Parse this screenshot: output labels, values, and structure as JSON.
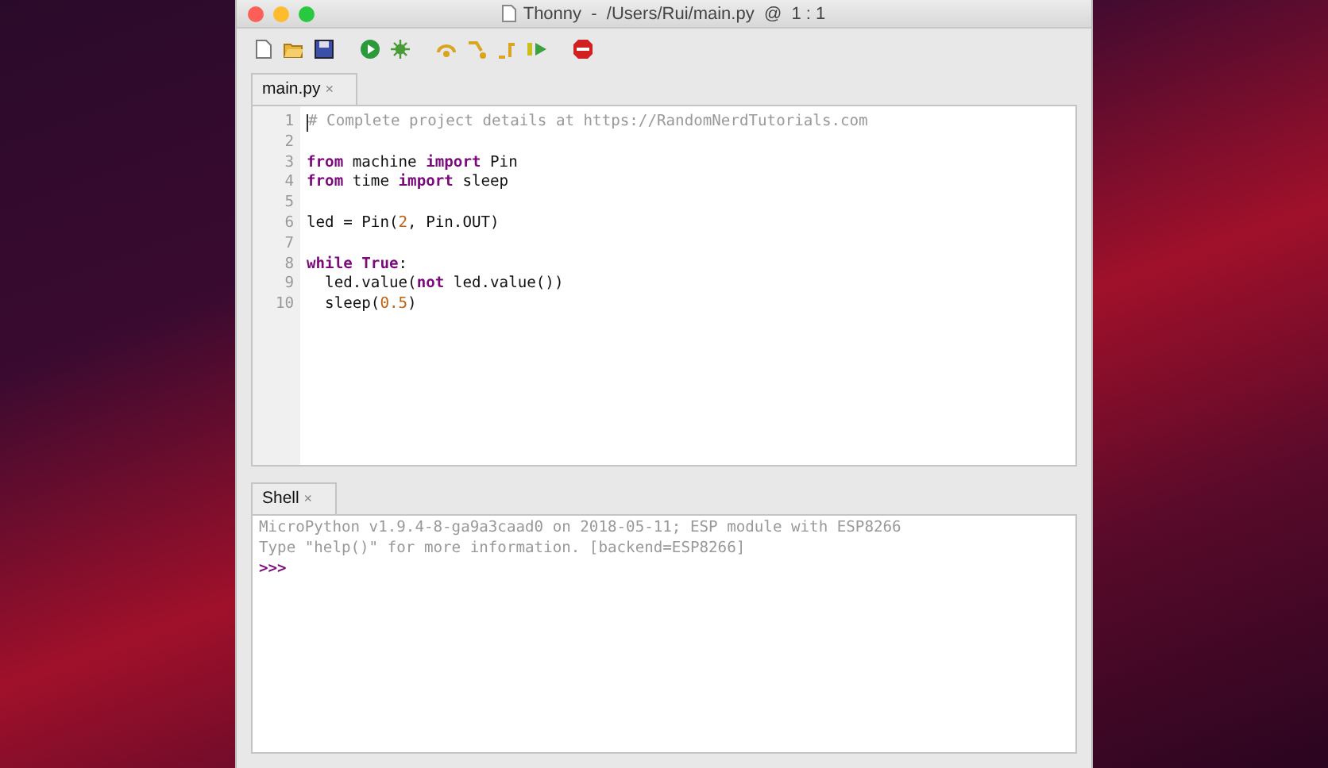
{
  "window": {
    "title": "Thonny  -  /Users/Rui/main.py  @  1 : 1"
  },
  "toolbar": [
    {
      "kind": "new"
    },
    {
      "kind": "open"
    },
    {
      "kind": "save"
    },
    {
      "kind": "run"
    },
    {
      "kind": "debug"
    },
    {
      "kind": "step_over"
    },
    {
      "kind": "step_into"
    },
    {
      "kind": "step_out"
    },
    {
      "kind": "resume"
    },
    {
      "kind": "stop"
    }
  ],
  "editor": {
    "tab": {
      "label": "main.py",
      "close": "×",
      "selected": true
    },
    "lines": [
      {
        "number": "1",
        "tokens": [
          {
            "kind": "comment",
            "text": "# Complete project details at https://RandomNerdTutorials.com"
          }
        ]
      },
      {
        "number": "2"
      },
      {
        "number": "3",
        "tokens": [
          {
            "kind": "keyword",
            "text": "from"
          },
          {
            "kind": "plain",
            "text": " machine "
          },
          {
            "kind": "keyword",
            "text": "import"
          },
          {
            "kind": "plain",
            "text": " Pin"
          }
        ]
      },
      {
        "number": "4",
        "tokens": [
          {
            "kind": "keyword",
            "text": "from"
          },
          {
            "kind": "plain",
            "text": " time "
          },
          {
            "kind": "keyword",
            "text": "import"
          },
          {
            "kind": "plain",
            "text": " sleep"
          }
        ]
      },
      {
        "number": "5"
      },
      {
        "number": "6",
        "tokens": [
          {
            "kind": "plain",
            "text": "led = Pin("
          },
          {
            "kind": "number",
            "text": "2"
          },
          {
            "kind": "plain",
            "text": ", Pin.OUT)"
          }
        ]
      },
      {
        "number": "7"
      },
      {
        "number": "8",
        "tokens": [
          {
            "kind": "keyword",
            "text": "while True"
          },
          {
            "kind": "plain",
            "text": ":"
          }
        ]
      },
      {
        "number": "9",
        "tokens": [
          {
            "kind": "plain",
            "text": "  led.value("
          },
          {
            "kind": "keyword",
            "text": "not"
          },
          {
            "kind": "plain",
            "text": " led.value())"
          }
        ]
      },
      {
        "number": "10",
        "tokens": [
          {
            "kind": "plain",
            "text": "  sleep("
          },
          {
            "kind": "number",
            "text": "0.5"
          },
          {
            "kind": "plain",
            "text": ")"
          }
        ]
      }
    ]
  },
  "shell": {
    "tab": {
      "label": "Shell",
      "close": "×",
      "selected": true
    },
    "lines": [
      {
        "kind": "output",
        "text": "MicroPython v1.9.4-8-ga9a3caad0 on 2018-05-11; ESP module with ESP8266"
      },
      {
        "kind": "output",
        "text": "Type \"help()\" for more information. [backend=ESP8266]"
      },
      {
        "kind": "prompt",
        "text": ">>>"
      }
    ]
  }
}
